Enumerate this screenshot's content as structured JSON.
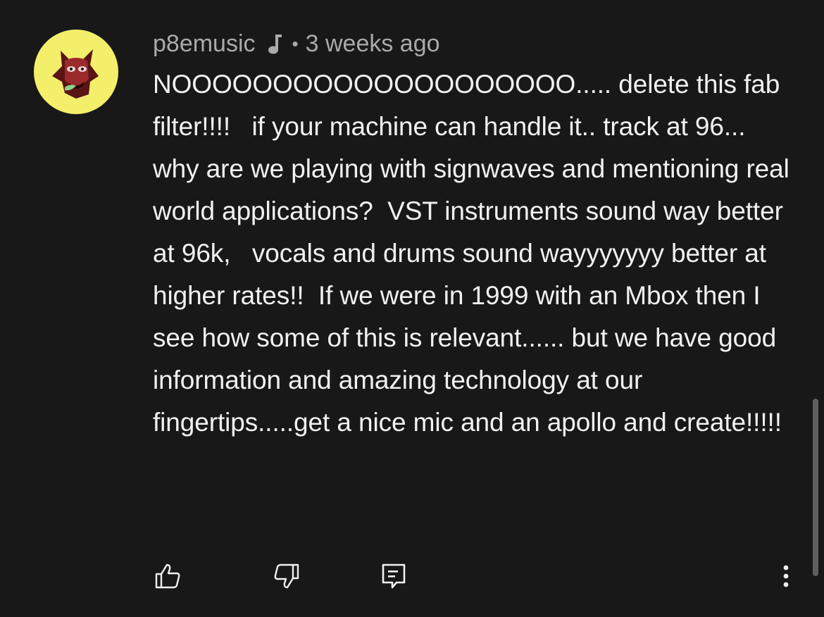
{
  "comment": {
    "author": "p8emusic",
    "separator": "•",
    "time": "3 weeks ago",
    "badge_icon": "music-note-icon",
    "avatar_icon": "avatar-image",
    "avatar_bg": "#f3ef6b",
    "text": "NOOOOOOOOOOOOOOOOOOOO..... delete this fab filter!!!!   if your machine can handle it.. track at 96...   why are we playing with signwaves and mentioning real world applications?  VST instruments sound way better at 96k,   vocals and drums sound wayyyyyyy better at higher rates!!  If we were in 1999 with an Mbox then I see how some of this is relevant...... but we have good information and amazing technology at our fingertips.....get a nice mic and an apollo and create!!!!!"
  },
  "actions": {
    "like_icon": "thumbs-up-icon",
    "dislike_icon": "thumbs-down-icon",
    "reply_icon": "reply-icon",
    "more_icon": "more-vertical-icon"
  },
  "colors": {
    "background": "#181818",
    "text": "#f1f1f1",
    "meta": "#aaaaaa"
  }
}
